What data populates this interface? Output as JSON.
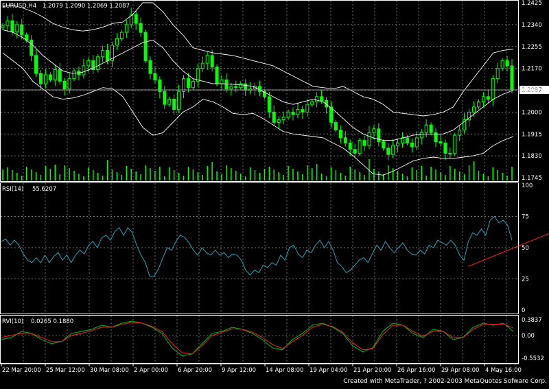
{
  "window": {
    "background": "#000000",
    "grid_color": "#9a9a9a",
    "frame_color": "#ffffff"
  },
  "credit": "Created with MetaTrader, ? 2002-2003 MetaQuotes Sofware Corp.",
  "chart_data": [
    {
      "type": "candlestick",
      "title": "EURUSD,H4",
      "ohlc_label": "1.2079 1.2090 1.2069 1.2087",
      "symbol": "EURUSD",
      "timeframe": "H4",
      "last_price": "1.2087",
      "ylim": [
        1.1745,
        1.2425
      ],
      "y_ticks": [
        "1.2425",
        "1.2340",
        "1.2255",
        "1.2170",
        "1.2085",
        "1.2000",
        "1.1915",
        "1.1830",
        "1.1745"
      ],
      "x_ticks": [
        "22 Mar 20:00",
        "25 Mar 12:00",
        "30 Mar 08:00",
        "2 Apr 00:00",
        "6 Apr 20:00",
        "9 Apr 12:00",
        "14 Apr 08:00",
        "19 Apr 04:00",
        "21 Apr 20:00",
        "26 Apr 16:00",
        "29 Apr 08:00",
        "4 May 16:00"
      ],
      "grid": true,
      "colors": {
        "bull": "#00ff00",
        "bear": "#00ff00",
        "bands": "#ffffff",
        "volume": "#00ff00"
      },
      "indicators": [
        "Bollinger Bands",
        "Volume"
      ],
      "close_series": [
        1.2335,
        1.2355,
        1.2312,
        1.234,
        1.23,
        1.228,
        1.222,
        1.215,
        1.211,
        1.2145,
        1.2125,
        1.2165,
        1.212,
        1.209,
        1.213,
        1.216,
        1.2145,
        1.218,
        1.22,
        1.2165,
        1.2215,
        1.224,
        1.22,
        1.226,
        1.2285,
        1.231,
        1.234,
        1.238,
        1.2345,
        1.231,
        1.22,
        1.215,
        1.2125,
        1.208,
        1.203,
        1.205,
        1.201,
        1.208,
        1.213,
        1.2095,
        1.212,
        1.217,
        1.219,
        1.222,
        1.2175,
        1.211,
        1.2125,
        1.209,
        1.21,
        1.2095,
        1.211,
        1.2085,
        1.209,
        1.21,
        1.208,
        1.206,
        1.2,
        1.196,
        1.197,
        1.198,
        1.2,
        1.199,
        1.201,
        1.2,
        1.203,
        1.204,
        1.206,
        1.2045,
        1.202,
        1.196,
        1.193,
        1.19,
        1.188,
        1.1855,
        1.184,
        1.189,
        1.187,
        1.192,
        1.1935,
        1.1885,
        1.186,
        1.1835,
        1.187,
        1.188,
        1.19,
        1.188,
        1.1865,
        1.19,
        1.192,
        1.195,
        1.192,
        1.1885,
        1.188,
        1.184,
        1.184,
        1.191,
        1.193,
        1.197,
        1.2,
        1.202,
        1.204,
        1.206,
        1.205,
        1.213,
        1.217,
        1.22,
        1.218,
        1.2087
      ],
      "upper_band": [
        1.241,
        1.2415,
        1.2405,
        1.239,
        1.237,
        1.2345,
        1.233,
        1.232,
        1.2315,
        1.232,
        1.233,
        1.2345,
        1.235,
        1.238,
        1.2425,
        1.2425,
        1.239,
        1.234,
        1.23,
        1.225,
        1.224,
        1.223,
        1.2225,
        1.222,
        1.221,
        1.22,
        1.219,
        1.218,
        1.216,
        1.214,
        1.212,
        1.21,
        1.2095,
        1.209,
        1.21,
        1.208,
        1.206,
        1.205,
        1.203,
        1.2,
        1.1995,
        1.199,
        1.1985,
        1.199,
        1.2,
        1.202,
        1.208,
        1.213,
        1.218,
        1.223,
        1.224,
        1.2245
      ],
      "mid_band": [
        1.232,
        1.231,
        1.229,
        1.226,
        1.222,
        1.219,
        1.216,
        1.215,
        1.2155,
        1.217,
        1.219,
        1.221,
        1.223,
        1.225,
        1.227,
        1.228,
        1.225,
        1.22,
        1.216,
        1.213,
        1.212,
        1.211,
        1.211,
        1.2108,
        1.2105,
        1.21,
        1.208,
        1.206,
        1.204,
        1.203,
        1.204,
        1.205,
        1.204,
        1.201,
        1.1975,
        1.194,
        1.1915,
        1.19,
        1.189,
        1.189,
        1.19,
        1.191,
        1.1915,
        1.1915,
        1.1915,
        1.193,
        1.196,
        1.199,
        1.202,
        1.205,
        1.207,
        1.2085
      ],
      "lower_band": [
        1.223,
        1.22,
        1.217,
        1.212,
        1.209,
        1.206,
        1.205,
        1.2055,
        1.2065,
        1.208,
        1.2095,
        1.209,
        1.206,
        1.2,
        1.194,
        1.191,
        1.192,
        1.196,
        1.2,
        1.202,
        1.205,
        1.204,
        1.202,
        1.1995,
        1.199,
        1.1995,
        1.1975,
        1.195,
        1.1925,
        1.1915,
        1.191,
        1.1905,
        1.19,
        1.188,
        1.186,
        1.183,
        1.1795,
        1.176,
        1.1755,
        1.177,
        1.179,
        1.181,
        1.182,
        1.1825,
        1.182,
        1.182,
        1.1825,
        1.183,
        1.184,
        1.187,
        1.189,
        1.1905
      ]
    },
    {
      "type": "line",
      "title": "RSI(14)",
      "value_label": "55.6207",
      "ylim": [
        0,
        100
      ],
      "y_ticks": [
        "100",
        "75",
        "50",
        "25",
        "0"
      ],
      "colors": {
        "line": "#2aa3b3",
        "trendline": "#ff2020"
      },
      "values": [
        55,
        57,
        52,
        56,
        52,
        45,
        40,
        38,
        42,
        38,
        44,
        38,
        43,
        46,
        40,
        44,
        38,
        44,
        48,
        45,
        52,
        55,
        50,
        58,
        60,
        56,
        63,
        66,
        60,
        66,
        62,
        52,
        44,
        38,
        27,
        27,
        33,
        42,
        50,
        48,
        55,
        60,
        58,
        54,
        48,
        44,
        50,
        46,
        44,
        48,
        44,
        46,
        42,
        45,
        44,
        40,
        32,
        28,
        32,
        30,
        36,
        34,
        38,
        36,
        44,
        40,
        50,
        52,
        45,
        42,
        48,
        46,
        52,
        56,
        50,
        55,
        48,
        38,
        35,
        30,
        32,
        36,
        40,
        42,
        38,
        45,
        52,
        48,
        55,
        50,
        46,
        50,
        54,
        48,
        45,
        44,
        48,
        45,
        52,
        50,
        56,
        54,
        52,
        56,
        52,
        44,
        40,
        55,
        62,
        60,
        65,
        60,
        72,
        75,
        70,
        72,
        68,
        56
      ],
      "trendline": {
        "from": {
          "index": 107,
          "value": 35
        },
        "to": {
          "index": 133,
          "value": 72
        }
      }
    },
    {
      "type": "line",
      "title": "RVI(10)",
      "value_label": "0.0265 0.1880",
      "ylim": [
        -0.5532,
        0.3837
      ],
      "y_ticks": [
        "0.3837",
        "0.00",
        "-0.5532"
      ],
      "series": [
        {
          "color": "#00c000",
          "values": [
            -0.1,
            -0.05,
            0.1,
            0.05,
            -0.1,
            -0.2,
            -0.15,
            0.05,
            0.1,
            0.15,
            0.25,
            0.2,
            0.3,
            0.35,
            0.3,
            0.2,
            0.05,
            -0.3,
            -0.5,
            -0.45,
            -0.2,
            0.05,
            0.1,
            0.2,
            0.15,
            0.05,
            -0.1,
            -0.3,
            -0.35,
            -0.1,
            0.05,
            0.25,
            0.3,
            0.2,
            0.05,
            -0.25,
            -0.4,
            -0.3,
            0.1,
            0.3,
            0.25,
            0.05,
            -0.05,
            0.15,
            0.1,
            -0.1,
            -0.05,
            0.2,
            0.3,
            0.25,
            0.3,
            0.1
          ]
        },
        {
          "color": "#ff2020",
          "values": [
            -0.05,
            0.0,
            0.05,
            0.05,
            -0.05,
            -0.15,
            -0.15,
            0.0,
            0.05,
            0.12,
            0.2,
            0.2,
            0.27,
            0.32,
            0.3,
            0.22,
            0.1,
            -0.2,
            -0.42,
            -0.45,
            -0.25,
            0.0,
            0.08,
            0.16,
            0.15,
            0.08,
            -0.05,
            -0.22,
            -0.32,
            -0.15,
            0.0,
            0.2,
            0.27,
            0.22,
            0.08,
            -0.18,
            -0.35,
            -0.32,
            0.02,
            0.25,
            0.25,
            0.1,
            -0.02,
            0.1,
            0.1,
            -0.05,
            -0.05,
            0.15,
            0.27,
            0.27,
            0.28,
            0.18
          ]
        }
      ]
    }
  ]
}
